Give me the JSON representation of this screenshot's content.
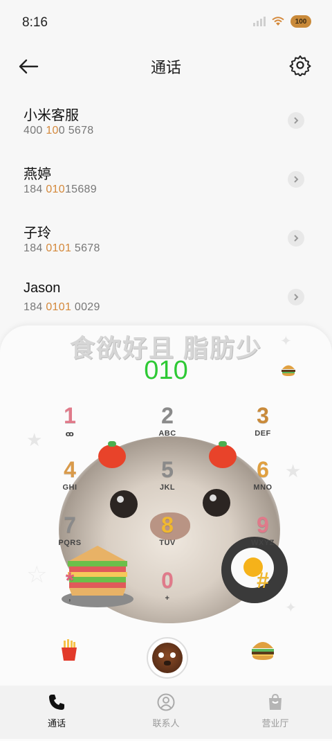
{
  "status": {
    "time": "8:16",
    "battery": "100"
  },
  "header": {
    "title": "通话"
  },
  "calls": [
    {
      "name": "小米客服",
      "number_pre": "400 ",
      "number_hl": "10",
      "number_post": "0 5678"
    },
    {
      "name": "燕婷",
      "number_pre": "184 ",
      "number_hl": "010",
      "number_post": "15689"
    },
    {
      "name": "子玲",
      "number_pre": "184 ",
      "number_hl": "0101",
      "number_post": " 5678"
    },
    {
      "name": "Jason",
      "number_pre": "184 ",
      "number_hl": "0101",
      "number_post": " 0029"
    }
  ],
  "dialer": {
    "banner": "食欲好且 脂肪少",
    "input": "010",
    "keys": [
      {
        "digit": "1",
        "letters": "ꝏ",
        "color": "#e07a8a"
      },
      {
        "digit": "2",
        "letters": "ABC",
        "color": "#8a8a8a"
      },
      {
        "digit": "3",
        "letters": "DEF",
        "color": "#c98a3a"
      },
      {
        "digit": "4",
        "letters": "GHI",
        "color": "#d99a4a"
      },
      {
        "digit": "5",
        "letters": "JKL",
        "color": "#8a8a8a"
      },
      {
        "digit": "6",
        "letters": "MNO",
        "color": "#e0a040"
      },
      {
        "digit": "7",
        "letters": "PQRS",
        "color": "#8a8a8a"
      },
      {
        "digit": "8",
        "letters": "TUV",
        "color": "#f0b830"
      },
      {
        "digit": "9",
        "letters": "WXYZ",
        "color": "#e07a8a"
      },
      {
        "digit": "*",
        "letters": ",",
        "color": "#e0607a"
      },
      {
        "digit": "0",
        "letters": "+",
        "color": "#e07a8a"
      },
      {
        "digit": "#",
        "letters": "",
        "color": "#f0b830"
      }
    ]
  },
  "tabs": [
    {
      "label": "通话",
      "icon": "phone-icon"
    },
    {
      "label": "联系人",
      "icon": "contact-icon"
    },
    {
      "label": "营业厅",
      "icon": "bag-icon"
    }
  ],
  "colors": {
    "accent": "#2ec935",
    "highlight": "#d4883a"
  }
}
